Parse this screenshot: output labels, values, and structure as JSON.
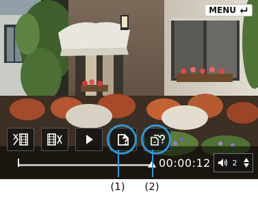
{
  "menu": {
    "label": "MENU",
    "return_icon": "return-arrow-icon"
  },
  "controls": [
    {
      "icon": "trim-beginning-icon",
      "label": ""
    },
    {
      "icon": "trim-end-icon",
      "label": ""
    },
    {
      "icon": "play-icon",
      "label": ""
    },
    {
      "icon": "save-icon",
      "label": ""
    },
    {
      "icon": "save-as-new-file-icon",
      "label": ""
    }
  ],
  "playback": {
    "timecode": "00:00:12",
    "progress_fraction": 1.0
  },
  "volume": {
    "icon": "speaker-icon",
    "level": "2"
  },
  "callouts": [
    {
      "text": "(1)",
      "target": "save-button"
    },
    {
      "text": "(2)",
      "target": "save-as-button"
    }
  ],
  "colors": {
    "accent": "#2b9ad6",
    "screen_bg": "#0b0b0b"
  }
}
